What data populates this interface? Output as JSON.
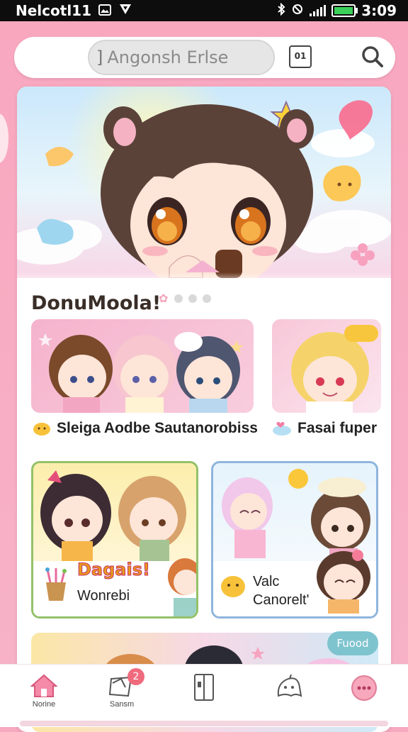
{
  "status_bar": {
    "carrier": "Nelcotl11",
    "time": "3:09"
  },
  "search": {
    "caret": "]",
    "placeholder": "Angonsh Erlse",
    "tab_badge": "01"
  },
  "feed": {
    "section_title": "DonuMoola!",
    "row1": [
      {
        "caption": "Sleiga Aodbe Sautanorobiss"
      },
      {
        "caption": "Fasai fuper"
      }
    ],
    "row2": [
      {
        "title": "Dagais!",
        "subtitle": "Wonrebi"
      },
      {
        "title": "Valc",
        "subtitle": "Canorelt'"
      }
    ],
    "strip_badge": "Fuood"
  },
  "bottom_nav": {
    "items": [
      {
        "label": "Norine"
      },
      {
        "label": "Sansm"
      },
      {
        "label": ""
      },
      {
        "label": ""
      },
      {
        "label": ""
      }
    ],
    "notification_count": "2"
  },
  "colors": {
    "app_background": "#f7a9c0",
    "accent_pink": "#f06a7d",
    "tile_green_border": "#94c16a",
    "tile_blue_border": "#8fb5dd",
    "badge_teal": "#7ec4cf"
  }
}
